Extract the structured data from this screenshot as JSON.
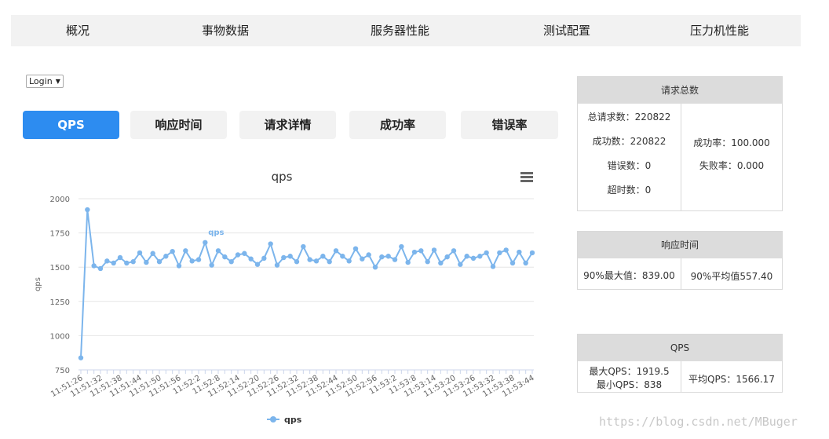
{
  "nav": [
    "概况",
    "事物数据",
    "服务器性能",
    "测试配置",
    "压力机性能"
  ],
  "selector": {
    "selected": "Login"
  },
  "tabs": [
    "QPS",
    "响应时间",
    "请求详情",
    "成功率",
    "错误率"
  ],
  "colors": {
    "accent": "#2d8cf0",
    "series": "#7cb5ec",
    "header_bg": "#dcdcdc",
    "nav_bg": "#f2f2f2"
  },
  "chart_data": {
    "type": "line",
    "title": "qps",
    "ylabel": "qps",
    "ylim": [
      750,
      2000
    ],
    "yticks": [
      750,
      1000,
      1250,
      1500,
      1750,
      2000
    ],
    "legend": {
      "position": "bottom",
      "entries": [
        "qps"
      ]
    },
    "series": [
      {
        "name": "qps",
        "values": [
          838,
          1919.5,
          1510,
          1490,
          1545,
          1530,
          1570,
          1530,
          1540,
          1605,
          1535,
          1600,
          1540,
          1580,
          1615,
          1510,
          1620,
          1545,
          1555,
          1680,
          1515,
          1620,
          1575,
          1540,
          1590,
          1600,
          1560,
          1520,
          1565,
          1670,
          1515,
          1570,
          1580,
          1540,
          1650,
          1555,
          1545,
          1580,
          1540,
          1620,
          1580,
          1545,
          1635,
          1560,
          1590,
          1500,
          1575,
          1580,
          1555,
          1650,
          1535,
          1610,
          1620,
          1540,
          1625,
          1530,
          1575,
          1620,
          1520,
          1580,
          1565,
          1580,
          1605,
          1505,
          1605,
          1625,
          1530,
          1610,
          1530,
          1605
        ]
      }
    ],
    "peak_label": {
      "text": "qps",
      "index": 19
    },
    "xlabels": [
      "11:51:26",
      "11:51:32",
      "11:51:38",
      "11:51:44",
      "11:51:50",
      "11:51:56",
      "11:52:2",
      "11:52:8",
      "11:52:14",
      "11:52:20",
      "11:52:26",
      "11:52:32",
      "11:52:38",
      "11:52:44",
      "11:52:50",
      "11:52:56",
      "11:53:2",
      "11:53:8",
      "11:53:14",
      "11:53:20",
      "11:53:26",
      "11:53:32",
      "11:53:38",
      "11:53:44"
    ]
  },
  "panels": {
    "requests": {
      "title": "请求总数",
      "left": [
        "总请求数：220822",
        "成功数：220822",
        "错误数：0",
        "超时数：0"
      ],
      "right": [
        "成功率：100.000",
        "失败率：0.000"
      ]
    },
    "response": {
      "title": "响应时间",
      "left": "90%最大值：839.00",
      "right": "90%平均值557.40"
    },
    "qps": {
      "title": "QPS",
      "left": [
        "最大QPS：1919.5",
        "最小QPS：838"
      ],
      "right": "平均QPS：1566.17"
    }
  },
  "watermark": "https://blog.csdn.net/MBuger"
}
